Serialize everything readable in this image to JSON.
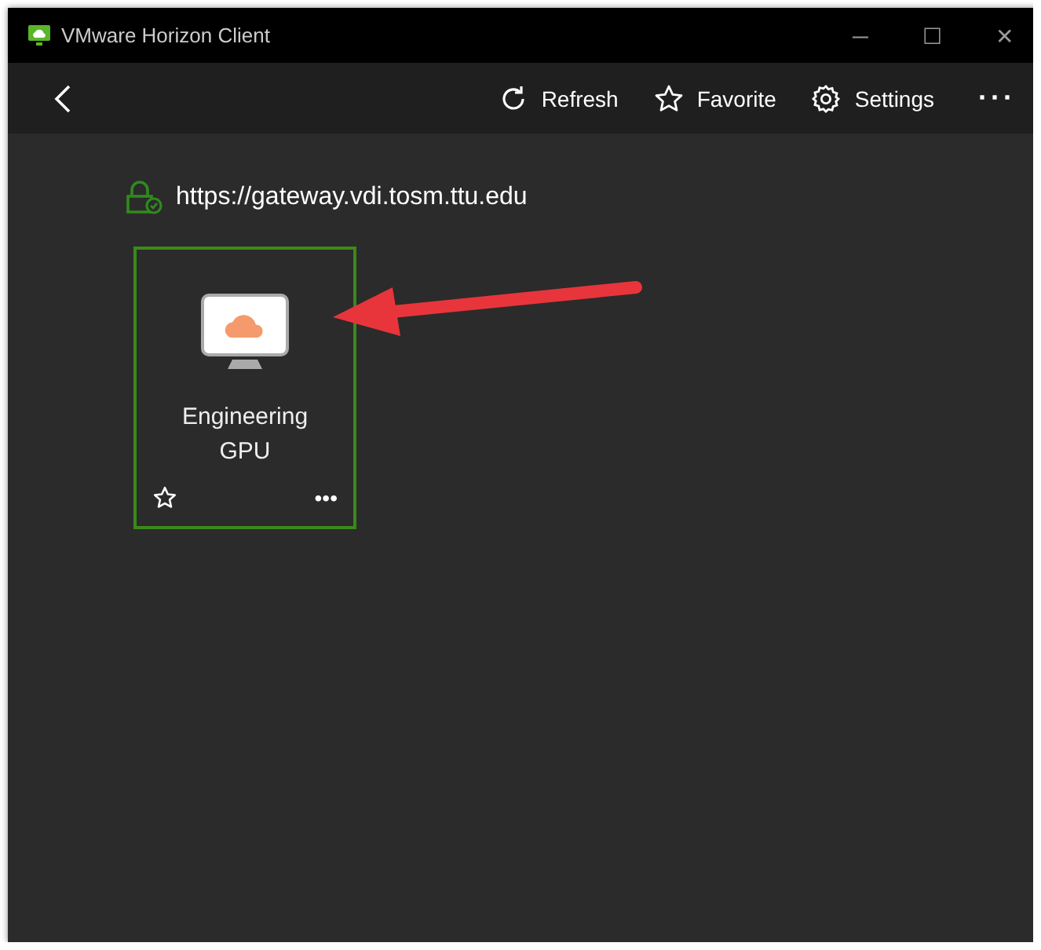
{
  "window": {
    "title": "VMware Horizon Client",
    "controls": [
      "─",
      "☐",
      "✕"
    ]
  },
  "toolbar": {
    "items": [
      {
        "kind": "refresh",
        "label": "Refresh"
      },
      {
        "kind": "favorite",
        "label": "Favorite"
      },
      {
        "kind": "settings",
        "label": "Settings"
      }
    ],
    "more": "···"
  },
  "server": {
    "url": "https://gateway.vdi.tosm.ttu.edu"
  },
  "desktops": [
    {
      "name": "Engineering\nGPU",
      "selected": true,
      "favorite": false,
      "more": "•••"
    }
  ]
}
